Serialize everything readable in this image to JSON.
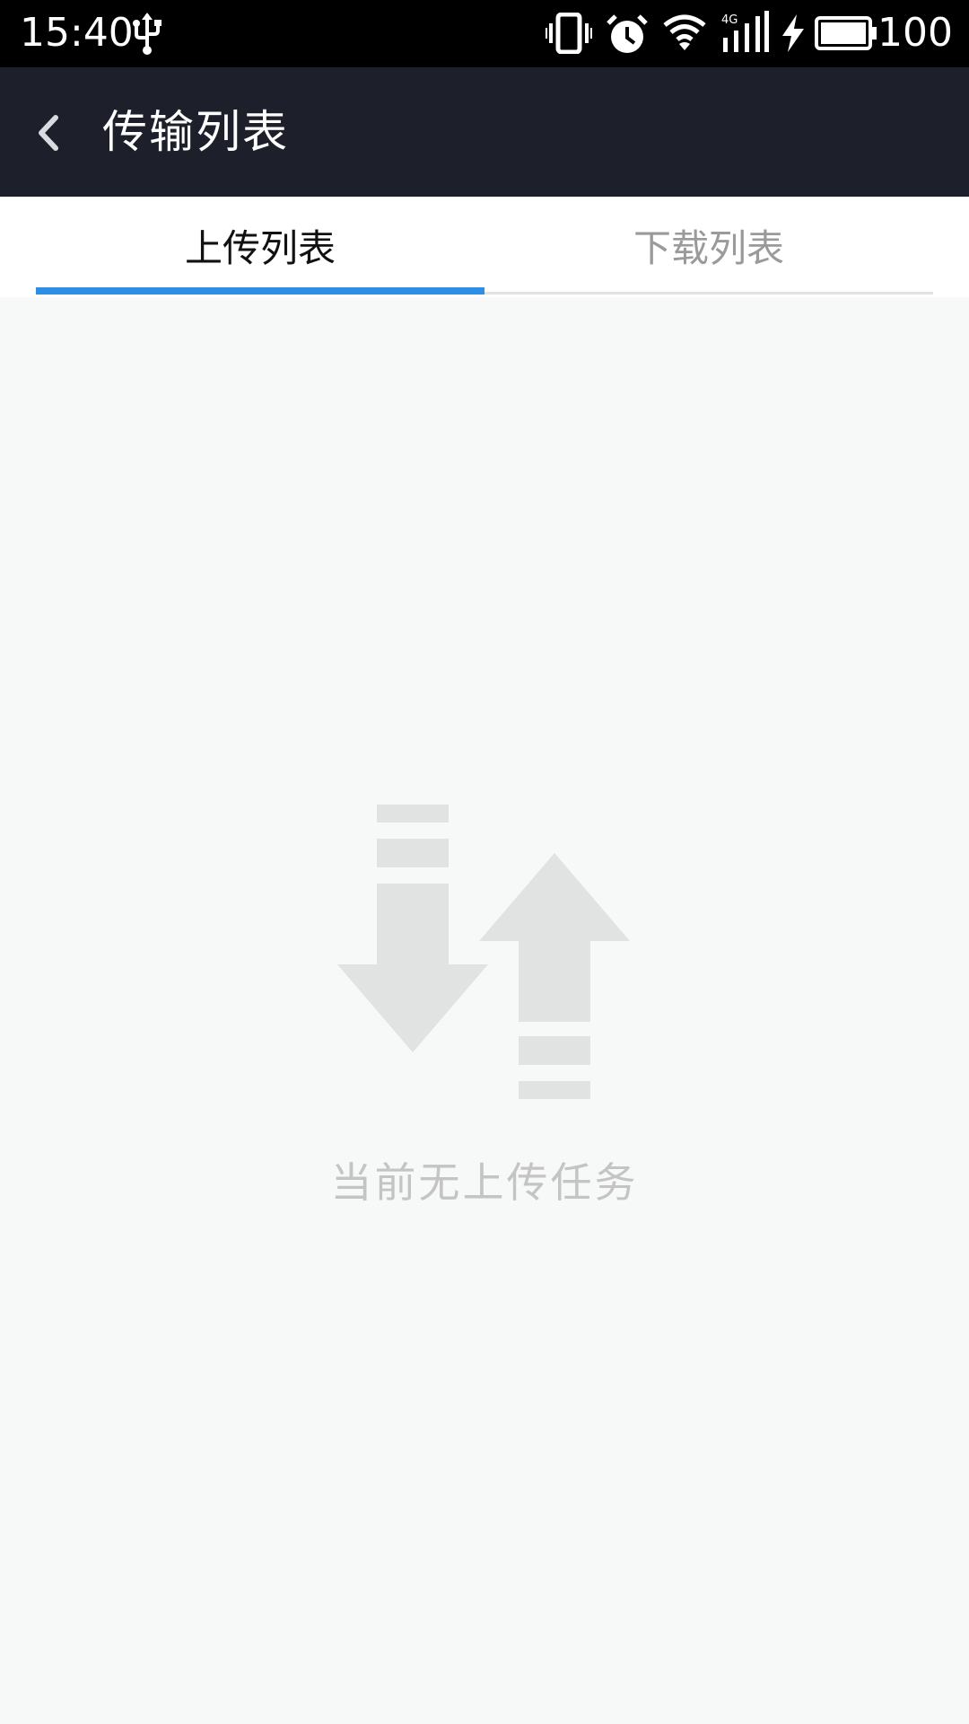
{
  "status_bar": {
    "time": "15:40",
    "battery_level": "100",
    "network_type": "4G",
    "icons": [
      "usb-icon",
      "vibrate-icon",
      "alarm-icon",
      "wifi-icon",
      "cellular-signal-icon",
      "charging-icon",
      "battery-icon"
    ]
  },
  "toolbar": {
    "title": "传输列表",
    "back_icon": "chevron-left-icon"
  },
  "tabs": [
    {
      "label": "上传列表",
      "selected": true
    },
    {
      "label": "下载列表",
      "selected": false
    }
  ],
  "colors": {
    "accent": "#2d8ee6",
    "toolbar_bg": "#1d202a",
    "page_bg": "#f7f8f8",
    "empty_icon": "#e1e2e2",
    "empty_text": "#c4c4c4"
  },
  "empty_state": {
    "icon": "transfer-arrows-icon",
    "message": "当前无上传任务"
  }
}
